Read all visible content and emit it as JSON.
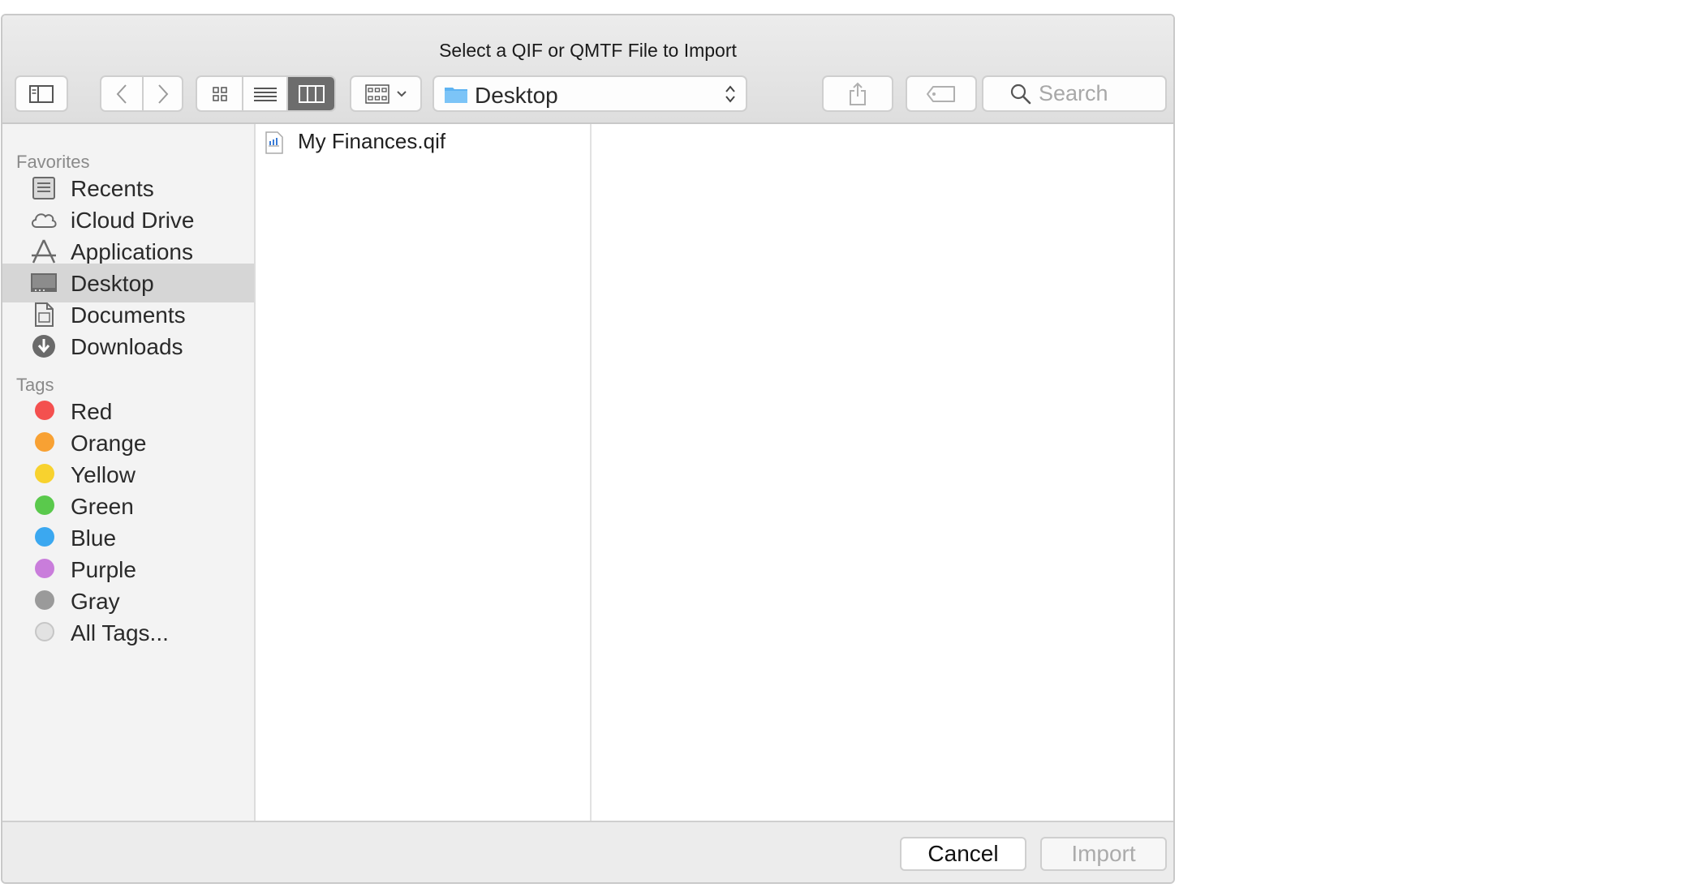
{
  "dialog": {
    "title": "Select a QIF or QMTF File to Import"
  },
  "toolbar": {
    "sidebar_toggle_icon": "sidebar-toggle-icon",
    "back_icon": "chevron-left-icon",
    "forward_icon": "chevron-right-icon",
    "views": [
      "icon-view",
      "list-view",
      "column-view"
    ],
    "active_view": "column-view",
    "arrange_icon": "group-grid-icon",
    "location": "Desktop",
    "share_icon": "share-icon",
    "tag_icon": "tag-icon"
  },
  "search": {
    "placeholder": "Search",
    "value": ""
  },
  "sidebar": {
    "favorites_label": "Favorites",
    "favorites": [
      {
        "label": "Recents",
        "icon": "recents-icon"
      },
      {
        "label": "iCloud Drive",
        "icon": "cloud-icon"
      },
      {
        "label": "Applications",
        "icon": "applications-icon"
      },
      {
        "label": "Desktop",
        "icon": "desktop-icon",
        "selected": true
      },
      {
        "label": "Documents",
        "icon": "document-icon"
      },
      {
        "label": "Downloads",
        "icon": "download-icon"
      }
    ],
    "tags_label": "Tags",
    "tags": [
      {
        "label": "Red",
        "color": "#f4504f"
      },
      {
        "label": "Orange",
        "color": "#f8a133"
      },
      {
        "label": "Yellow",
        "color": "#f8d22e"
      },
      {
        "label": "Green",
        "color": "#5ac94c"
      },
      {
        "label": "Blue",
        "color": "#3ba8f0"
      },
      {
        "label": "Purple",
        "color": "#c97ddb"
      },
      {
        "label": "Gray",
        "color": "#9a9a9a"
      },
      {
        "label": "All Tags...",
        "color": "#d8d8d8"
      }
    ]
  },
  "files": [
    {
      "name": "My Finances.qif",
      "icon": "qif-file-icon"
    }
  ],
  "footer": {
    "cancel_label": "Cancel",
    "import_label": "Import",
    "import_enabled": false
  },
  "colors": {
    "selection": "#d6d6d6",
    "folder_accent": "#5eb3f2",
    "active_segment": "#6d6d6d"
  }
}
